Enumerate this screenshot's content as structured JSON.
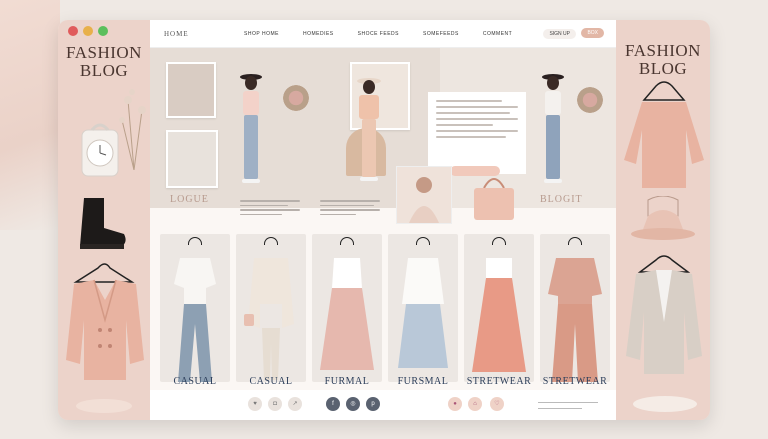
{
  "window": {
    "controls": [
      "close",
      "minimize",
      "maximize"
    ],
    "control_colors": [
      "#e05b5b",
      "#e8b04a",
      "#5cbf5c"
    ]
  },
  "brand": {
    "left_title": "FASHION BLOG",
    "right_title": "FASHION BLOG"
  },
  "nav": {
    "logo": "HOME",
    "items": [
      "SHOP HOME",
      "HOMEDIES",
      "SHOCE FEEDS",
      "SOMEFEEDS",
      "COMMENT"
    ],
    "signup": "SIGN UP",
    "pill": "BOX"
  },
  "sections": {
    "left_label": "LOGUE",
    "right_label": "BLOGIT"
  },
  "cards": [
    {
      "label": "CASUAL",
      "color": "#8da0b3"
    },
    {
      "label": "CASUAL",
      "color": "#efe6dc"
    },
    {
      "label": "FURMAL",
      "color": "#e6b8ae"
    },
    {
      "label": "FURSMAL",
      "color": "#b9c8d8"
    },
    {
      "label": "STRETWEAR",
      "color": "#e89a86"
    },
    {
      "label": "STRETWEAR",
      "color": "#dba493"
    }
  ],
  "colors": {
    "accent": "#e2b7a6",
    "panel": "#ecd3ca",
    "label": "#2c3e5a"
  },
  "social_icons": [
    "heart-icon",
    "bag-icon",
    "share-icon",
    "facebook-icon",
    "instagram-icon",
    "pinterest-icon",
    "circle-icon",
    "cart-icon",
    "heart-icon"
  ]
}
